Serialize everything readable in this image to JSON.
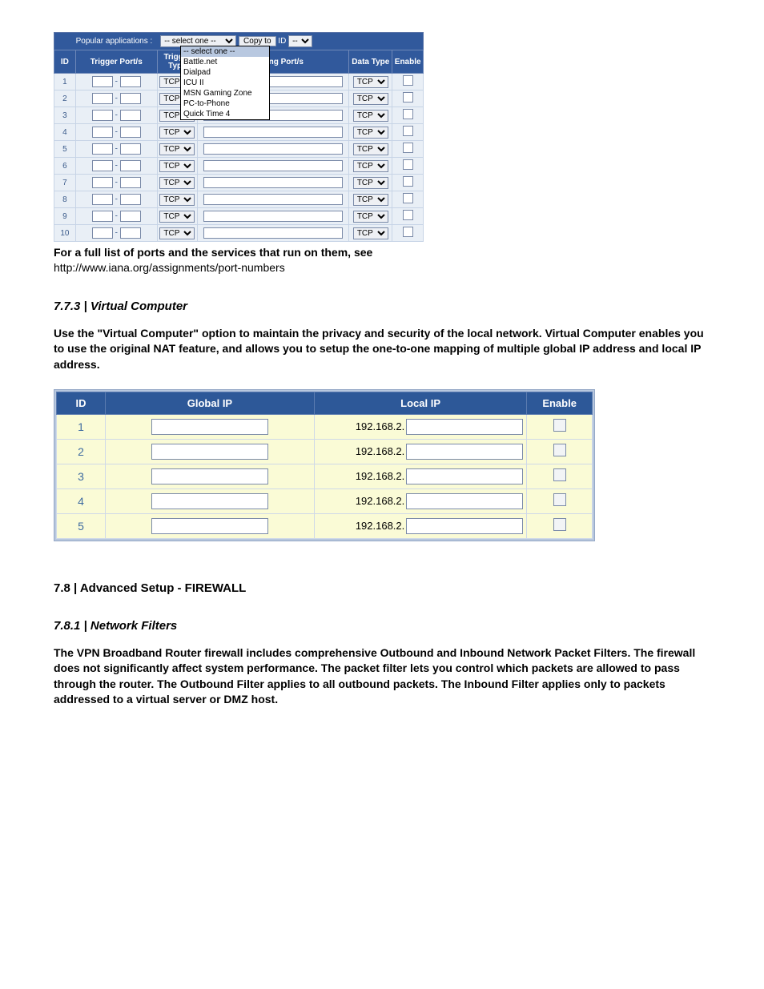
{
  "apps": {
    "popular_label": "Popular applications :",
    "select_placeholder": "-- select one --",
    "copy_btn": "Copy to",
    "id_label": "ID",
    "id_select_placeholder": "--",
    "dropdown_options": [
      "-- select one --",
      "Battle.net",
      "Dialpad",
      "ICU II",
      "MSN Gaming Zone",
      "PC-to-Phone",
      "Quick Time 4"
    ],
    "headers": {
      "id": "ID",
      "trigger_port": "Trigger Port/s",
      "trigger_type": "Trigger Type",
      "incoming_port": "Incoming Port/s",
      "data_type": "Data Type",
      "enable": "Enable"
    },
    "type_value": "TCP",
    "row_count": 10
  },
  "para_ports_1": "For a full list of ports and the services that run on them, see",
  "para_ports_url": "http://www.iana.org/assignments/port-numbers",
  "sections": {
    "vc_title": "7.7.3 | Virtual Computer",
    "vc_para": "Use the \"Virtual Computer\" option to maintain the privacy and security of the local network. Virtual Computer enables you to use the original NAT feature, and allows you to setup the one-to-one mapping of multiple global IP address and local IP address.",
    "fw_title": "7.8 | Advanced Setup - FIREWALL",
    "nf_title": "7.8.1 | Network Filters",
    "nf_para": "The VPN Broadband Router firewall includes comprehensive Outbound and Inbound Network Packet Filters. The firewall does not significantly affect system performance. The packet filter lets you control which packets are allowed to pass through the router. The Outbound Filter applies to all outbound packets. The Inbound Filter applies only to packets addressed to a virtual server or DMZ host."
  },
  "vc_table": {
    "headers": {
      "id": "ID",
      "global": "Global IP",
      "local": "Local IP",
      "enable": "Enable"
    },
    "prefix": "192.168.2.",
    "rows": [
      {
        "id": "1",
        "global": "",
        "local": ""
      },
      {
        "id": "2",
        "global": "",
        "local": ""
      },
      {
        "id": "3",
        "global": "",
        "local": ""
      },
      {
        "id": "4",
        "global": "",
        "local": ""
      },
      {
        "id": "5",
        "global": "",
        "local": ""
      }
    ]
  }
}
